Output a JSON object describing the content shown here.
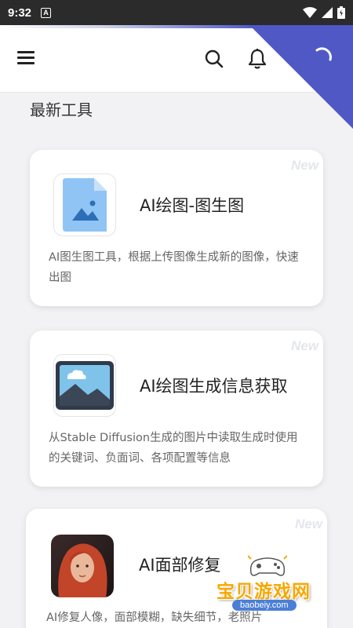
{
  "status_bar": {
    "time": "9:32",
    "notification_icon": "A"
  },
  "header": {
    "menu_icon": "menu-icon",
    "search_icon": "search-icon",
    "bell_icon": "bell-icon",
    "loading_icon": "loading-icon",
    "accent_color": "#5058c6"
  },
  "section": {
    "title": "最新工具"
  },
  "cards": [
    {
      "badge": "New",
      "title": "AI绘图-图生图",
      "description": "AI图生图工具，根据上传图像生成新的图像，快速出图",
      "icon": "image-file-icon"
    },
    {
      "badge": "New",
      "title": "AI绘图生成信息获取",
      "description": "从Stable Diffusion生成的图片中读取生成时使用的关键词、负面词、各项配置等信息",
      "icon": "landscape-image-icon"
    },
    {
      "badge": "New",
      "title": "AI面部修复",
      "description": "AI修复人像，面部模糊，缺失细节，老照片",
      "icon": "portrait-thumbnail"
    }
  ],
  "watermark": {
    "text": "宝贝游戏网",
    "url": "baobeiy.com"
  }
}
